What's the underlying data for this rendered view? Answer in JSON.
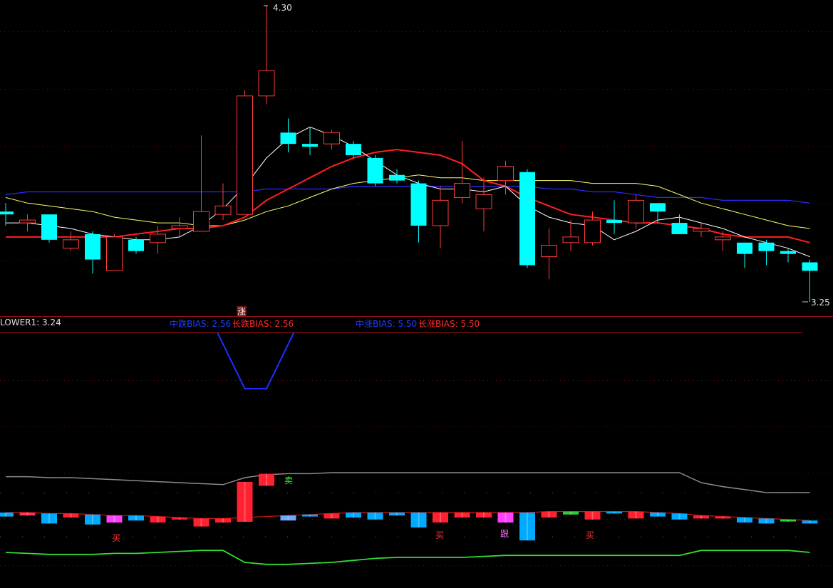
{
  "colors": {
    "up": "#ff3b3b",
    "down": "#00ffff",
    "ma_short": "#ffffff",
    "ma_mid": "#ff1e1e",
    "ma_long": "#ffff66",
    "ma_longest": "#2b2bff",
    "separator": "#a01010",
    "bias_line": "#1f2fff"
  },
  "price_labels": {
    "high_marker": "4.30",
    "low_marker": "3.25",
    "top_signal": "涨"
  },
  "indicator_legend": {
    "lower1": "LOWER1: 3.24",
    "mid_fall_bias": "中跌BIAS: 2.56",
    "long_fall_bias": "长跌BIAS: 2.56",
    "mid_rise_bias": "中涨BIAS: 5.50",
    "long_rise_bias": "长涨BIAS: 5.50"
  },
  "signals": {
    "buy_1": "买",
    "buy_2": "买",
    "follow": "跟",
    "buy_3": "买",
    "top_right": "卖"
  },
  "chart_data": {
    "type": "candlestick",
    "ohlc": [
      {
        "o": 3.57,
        "h": 3.6,
        "l": 3.52,
        "c": 3.56
      },
      {
        "o": 3.53,
        "h": 3.56,
        "l": 3.5,
        "c": 3.54
      },
      {
        "o": 3.56,
        "h": 3.56,
        "l": 3.46,
        "c": 3.47
      },
      {
        "o": 3.44,
        "h": 3.5,
        "l": 3.43,
        "c": 3.47
      },
      {
        "o": 3.49,
        "h": 3.5,
        "l": 3.35,
        "c": 3.4
      },
      {
        "o": 3.36,
        "h": 3.49,
        "l": 3.36,
        "c": 3.48
      },
      {
        "o": 3.47,
        "h": 3.48,
        "l": 3.42,
        "c": 3.43
      },
      {
        "o": 3.46,
        "h": 3.52,
        "l": 3.42,
        "c": 3.49
      },
      {
        "o": 3.51,
        "h": 3.55,
        "l": 3.48,
        "c": 3.52
      },
      {
        "o": 3.5,
        "h": 3.84,
        "l": 3.5,
        "c": 3.57
      },
      {
        "o": 3.56,
        "h": 3.67,
        "l": 3.54,
        "c": 3.59
      },
      {
        "o": 3.56,
        "h": 4.0,
        "l": 3.56,
        "c": 3.98
      },
      {
        "o": 3.98,
        "h": 4.3,
        "l": 3.95,
        "c": 4.07
      },
      {
        "o": 3.85,
        "h": 3.9,
        "l": 3.78,
        "c": 3.81
      },
      {
        "o": 3.81,
        "h": 3.87,
        "l": 3.77,
        "c": 3.8
      },
      {
        "o": 3.81,
        "h": 3.86,
        "l": 3.79,
        "c": 3.85
      },
      {
        "o": 3.81,
        "h": 3.82,
        "l": 3.76,
        "c": 3.77
      },
      {
        "o": 3.76,
        "h": 3.77,
        "l": 3.66,
        "c": 3.67
      },
      {
        "o": 3.7,
        "h": 3.72,
        "l": 3.67,
        "c": 3.68
      },
      {
        "o": 3.67,
        "h": 3.68,
        "l": 3.46,
        "c": 3.52
      },
      {
        "o": 3.52,
        "h": 3.66,
        "l": 3.44,
        "c": 3.61
      },
      {
        "o": 3.62,
        "h": 3.82,
        "l": 3.6,
        "c": 3.67
      },
      {
        "o": 3.58,
        "h": 3.69,
        "l": 3.5,
        "c": 3.63
      },
      {
        "o": 3.68,
        "h": 3.75,
        "l": 3.63,
        "c": 3.73
      },
      {
        "o": 3.71,
        "h": 3.72,
        "l": 3.37,
        "c": 3.38
      },
      {
        "o": 3.41,
        "h": 3.51,
        "l": 3.33,
        "c": 3.45
      },
      {
        "o": 3.46,
        "h": 3.54,
        "l": 3.43,
        "c": 3.48
      },
      {
        "o": 3.46,
        "h": 3.57,
        "l": 3.45,
        "c": 3.54
      },
      {
        "o": 3.54,
        "h": 3.61,
        "l": 3.49,
        "c": 3.53
      },
      {
        "o": 3.53,
        "h": 3.63,
        "l": 3.51,
        "c": 3.61
      },
      {
        "o": 3.6,
        "h": 3.6,
        "l": 3.53,
        "c": 3.57
      },
      {
        "o": 3.53,
        "h": 3.56,
        "l": 3.49,
        "c": 3.49
      },
      {
        "o": 3.5,
        "h": 3.53,
        "l": 3.48,
        "c": 3.51
      },
      {
        "o": 3.47,
        "h": 3.5,
        "l": 3.43,
        "c": 3.48
      },
      {
        "o": 3.46,
        "h": 3.46,
        "l": 3.37,
        "c": 3.42
      },
      {
        "o": 3.46,
        "h": 3.47,
        "l": 3.38,
        "c": 3.43
      },
      {
        "o": 3.43,
        "h": 3.44,
        "l": 3.39,
        "c": 3.42
      },
      {
        "o": 3.39,
        "h": 3.4,
        "l": 3.25,
        "c": 3.36
      }
    ],
    "ma_short": [
      3.53,
      3.53,
      3.52,
      3.51,
      3.49,
      3.48,
      3.47,
      3.47,
      3.48,
      3.52,
      3.58,
      3.66,
      3.76,
      3.83,
      3.87,
      3.84,
      3.8,
      3.75,
      3.7,
      3.67,
      3.65,
      3.65,
      3.64,
      3.66,
      3.59,
      3.55,
      3.53,
      3.52,
      3.47,
      3.5,
      3.54,
      3.55,
      3.53,
      3.51,
      3.48,
      3.46,
      3.44,
      3.41
    ],
    "ma_mid": [
      3.48,
      3.48,
      3.48,
      3.48,
      3.48,
      3.48,
      3.49,
      3.5,
      3.51,
      3.51,
      3.52,
      3.55,
      3.61,
      3.65,
      3.69,
      3.73,
      3.76,
      3.78,
      3.79,
      3.78,
      3.77,
      3.74,
      3.68,
      3.66,
      3.62,
      3.59,
      3.56,
      3.55,
      3.54,
      3.53,
      3.53,
      3.52,
      3.51,
      3.49,
      3.48,
      3.48,
      3.48,
      3.46
    ],
    "ma_long": [
      3.62,
      3.6,
      3.59,
      3.58,
      3.57,
      3.55,
      3.54,
      3.53,
      3.53,
      3.52,
      3.52,
      3.54,
      3.57,
      3.59,
      3.62,
      3.65,
      3.67,
      3.68,
      3.69,
      3.7,
      3.69,
      3.69,
      3.68,
      3.68,
      3.68,
      3.68,
      3.68,
      3.67,
      3.67,
      3.67,
      3.66,
      3.63,
      3.6,
      3.58,
      3.56,
      3.54,
      3.52,
      3.51
    ],
    "ma_longest": [
      3.63,
      3.64,
      3.64,
      3.64,
      3.64,
      3.64,
      3.64,
      3.64,
      3.64,
      3.64,
      3.64,
      3.64,
      3.65,
      3.65,
      3.65,
      3.65,
      3.66,
      3.66,
      3.66,
      3.66,
      3.66,
      3.66,
      3.66,
      3.66,
      3.66,
      3.65,
      3.65,
      3.64,
      3.64,
      3.63,
      3.62,
      3.62,
      3.62,
      3.61,
      3.61,
      3.61,
      3.61,
      3.6
    ],
    "bias_dip": [
      null,
      null,
      null,
      null,
      null,
      null,
      null,
      null,
      null,
      null,
      0.0,
      -1,
      -1,
      0.0,
      null,
      null,
      null,
      null,
      null,
      null,
      null,
      null,
      null,
      null,
      null,
      null,
      null,
      null,
      null,
      null,
      null,
      null,
      null,
      null,
      null,
      null,
      null,
      null
    ],
    "indicator_upper": [
      0.86,
      0.86,
      0.85,
      0.85,
      0.84,
      0.83,
      0.82,
      0.81,
      0.8,
      0.79,
      0.78,
      0.85,
      0.88,
      0.89,
      0.89,
      0.9,
      0.9,
      0.9,
      0.9,
      0.9,
      0.9,
      0.9,
      0.9,
      0.9,
      0.9,
      0.9,
      0.9,
      0.9,
      0.9,
      0.9,
      0.9,
      0.9,
      0.8,
      0.76,
      0.73,
      0.7,
      0.7,
      0.7
    ],
    "indicator_mid": [
      0.5,
      0.5,
      0.49,
      0.49,
      0.48,
      0.47,
      0.47,
      0.46,
      0.45,
      0.44,
      0.44,
      0.45,
      0.46,
      0.47,
      0.48,
      0.49,
      0.5,
      0.5,
      0.5,
      0.5,
      0.5,
      0.5,
      0.5,
      0.5,
      0.5,
      0.51,
      0.51,
      0.51,
      0.51,
      0.51,
      0.5,
      0.49,
      0.47,
      0.46,
      0.45,
      0.44,
      0.43,
      0.42
    ],
    "indicator_lower": [
      0.1,
      0.09,
      0.08,
      0.08,
      0.08,
      0.09,
      0.09,
      0.1,
      0.11,
      0.12,
      0.12,
      0.0,
      -0.02,
      -0.02,
      -0.01,
      0.0,
      0.02,
      0.04,
      0.05,
      0.05,
      0.05,
      0.05,
      0.06,
      0.07,
      0.07,
      0.07,
      0.07,
      0.07,
      0.07,
      0.07,
      0.07,
      0.07,
      0.12,
      0.12,
      0.12,
      0.12,
      0.12,
      0.1
    ],
    "indicator_bars": [
      {
        "v": 0.04,
        "c": "#00aaff"
      },
      {
        "v": 0.03,
        "c": "#ff3355"
      },
      {
        "v": 0.1,
        "c": "#00aaff"
      },
      {
        "v": 0.04,
        "c": "#ff2030"
      },
      {
        "v": 0.1,
        "c": "#00aaff"
      },
      {
        "v": 0.07,
        "c": "#ff40ff"
      },
      {
        "v": 0.05,
        "c": "#00aaff"
      },
      {
        "v": 0.06,
        "c": "#ff2030"
      },
      {
        "v": 0.02,
        "c": "#ff2030"
      },
      {
        "v": 0.08,
        "c": "#ff2030"
      },
      {
        "v": 0.04,
        "c": "#ff2030"
      },
      {
        "v": 0.4,
        "c": "#ff2030"
      },
      {
        "v": 0.12,
        "c": "#ff2030"
      },
      {
        "v": 0.05,
        "c": "#6fa8ff"
      },
      {
        "v": 0.02,
        "c": "#00aaff"
      },
      {
        "v": 0.05,
        "c": "#ff2030"
      },
      {
        "v": 0.05,
        "c": "#00aaff"
      },
      {
        "v": 0.07,
        "c": "#00aaff"
      },
      {
        "v": 0.03,
        "c": "#00aaff"
      },
      {
        "v": 0.15,
        "c": "#00aaff"
      },
      {
        "v": 0.1,
        "c": "#ff2030"
      },
      {
        "v": 0.05,
        "c": "#ff2030"
      },
      {
        "v": 0.05,
        "c": "#ff2030"
      },
      {
        "v": 0.1,
        "c": "#ff40ff"
      },
      {
        "v": 0.28,
        "c": "#00aaff"
      },
      {
        "v": 0.06,
        "c": "#ff2030"
      },
      {
        "v": 0.03,
        "c": "#33cc33"
      },
      {
        "v": 0.08,
        "c": "#ff2030"
      },
      {
        "v": 0.02,
        "c": "#00aaff"
      },
      {
        "v": 0.07,
        "c": "#ff2030"
      },
      {
        "v": 0.04,
        "c": "#00aaff"
      },
      {
        "v": 0.06,
        "c": "#00aaff"
      },
      {
        "v": 0.03,
        "c": "#ff2030"
      },
      {
        "v": 0.02,
        "c": "#ff2030"
      },
      {
        "v": 0.05,
        "c": "#00aaff"
      },
      {
        "v": 0.05,
        "c": "#00aaff"
      },
      {
        "v": 0.02,
        "c": "#33cc33"
      },
      {
        "v": 0.03,
        "c": "#00aaff"
      }
    ],
    "ylim": [
      3.22,
      4.33
    ]
  }
}
